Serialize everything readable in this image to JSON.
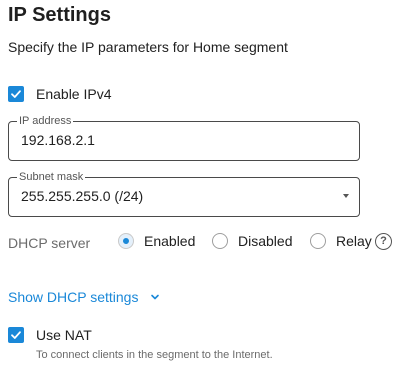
{
  "header": {
    "title": "IP Settings",
    "subtitle": "Specify the IP parameters for Home segment"
  },
  "ipv4": {
    "label": "Enable IPv4",
    "checked": true
  },
  "ip_address": {
    "legend": "IP address",
    "value": "192.168.2.1"
  },
  "subnet_mask": {
    "legend": "Subnet mask",
    "value": "255.255.255.0 (/24)"
  },
  "dhcp": {
    "label": "DHCP server",
    "options": [
      {
        "label": "Enabled",
        "selected": true
      },
      {
        "label": "Disabled",
        "selected": false
      },
      {
        "label": "Relay",
        "selected": false
      }
    ],
    "help_icon": "?"
  },
  "dhcp_settings_link": "Show DHCP settings",
  "nat": {
    "label": "Use NAT",
    "checked": true,
    "hint": "To connect clients in the segment to the Internet."
  },
  "colors": {
    "accent": "#1a88d8",
    "text": "#212121",
    "muted": "#6b6b6b"
  }
}
